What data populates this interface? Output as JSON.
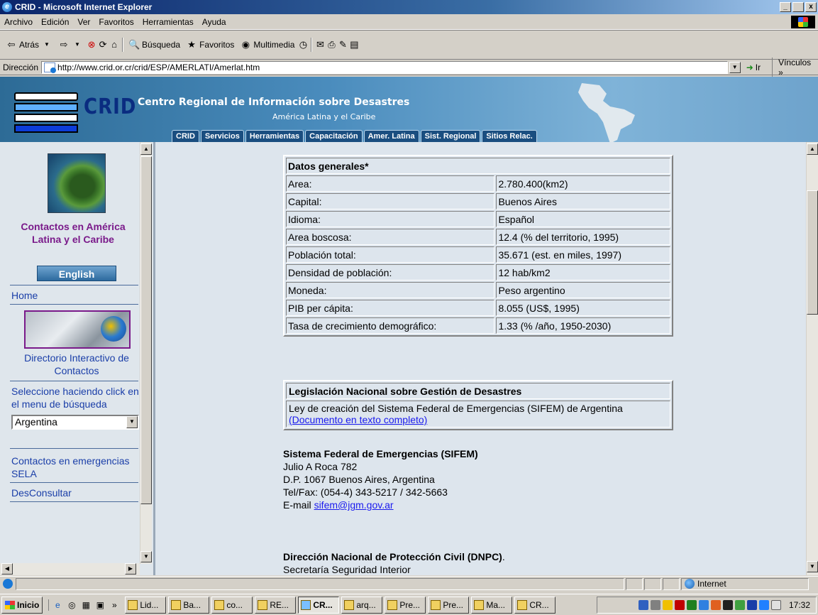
{
  "window": {
    "title": "CRID - Microsoft Internet Explorer",
    "minimize": "_",
    "maximize": " ",
    "close": "x"
  },
  "menu": [
    "Archivo",
    "Edición",
    "Ver",
    "Favoritos",
    "Herramientas",
    "Ayuda"
  ],
  "toolbar": {
    "back": "Atrás",
    "search": "Búsqueda",
    "favorites": "Favoritos",
    "media": "Multimedia"
  },
  "address": {
    "label": "Dirección",
    "url": "http://www.crid.or.cr/crid/ESP/AMERLATI/Amerlat.htm",
    "go": "Ir",
    "links": "Vínculos"
  },
  "banner": {
    "logo_text": "CRID",
    "title": "Centro Regional de Información sobre Desastres",
    "subtitle": "América Latina  y el Caribe",
    "tabs": [
      "CRID",
      "Servicios",
      "Herramientas",
      "Capacitación",
      "Amer. Latina",
      "Sist. Regional",
      "Sitios Relac."
    ]
  },
  "sidebar": {
    "heading": "Contactos en América Latina y el Caribe",
    "english": "English",
    "home": "Home",
    "directory": "Directorio Interactivo de Contactos",
    "select_prompt": "Seleccione haciendo click en el menu de búsqueda",
    "country": "Argentina",
    "emergency": "Contactos en emergencias SELA",
    "desconsultar": "DesConsultar"
  },
  "general_data": {
    "title": "Datos generales*",
    "rows": [
      {
        "label": "Area:",
        "value": "2.780.400(km2)"
      },
      {
        "label": "Capital:",
        "value": "Buenos Aires"
      },
      {
        "label": "Idioma:",
        "value": "Español"
      },
      {
        "label": "Area boscosa:",
        "value": "12.4 (% del territorio, 1995)"
      },
      {
        "label": "Población total:",
        "value": "35.671 (est. en miles, 1997)"
      },
      {
        "label": "Densidad de población:",
        "value": "12 hab/km2"
      },
      {
        "label": "Moneda:",
        "value": "Peso argentino"
      },
      {
        "label": "PIB per cápita:",
        "value": "8.055 (US$, 1995)"
      },
      {
        "label": "Tasa de crecimiento demográfico:",
        "value": "1.33 (% /año, 1950-2030)"
      }
    ]
  },
  "legislation": {
    "title": "Legislación Nacional sobre Gestión de Desastres",
    "text": "Ley de creación del Sistema Federal de Emergencias (SIFEM) de Argentina",
    "link": "(Documento en texto completo)"
  },
  "sifem": {
    "name": "Sistema Federal de Emergencias (SIFEM)",
    "address1": "Julio A Roca 782",
    "address2": "D.P. 1067 Buenos Aires, Argentina",
    "phone": "Tel/Fax: (054-4) 343-5217 / 342-5663",
    "email_label": "E-mail ",
    "email": "sifem@jgm.gov.ar"
  },
  "dnpc": {
    "name": "Dirección Nacional de Protección Civil (DNPC)",
    "dot": ".",
    "line1": "Secretaría Seguridad Interior"
  },
  "status": {
    "zone": "Internet"
  },
  "taskbar": {
    "start": "Inicio",
    "buttons": [
      "Lid...",
      "Ba...",
      "co...",
      "RE...",
      "CR...",
      "arq...",
      "Pre...",
      "Pre...",
      "Ma...",
      "CR..."
    ],
    "active_index": 4,
    "clock": "17:32"
  }
}
